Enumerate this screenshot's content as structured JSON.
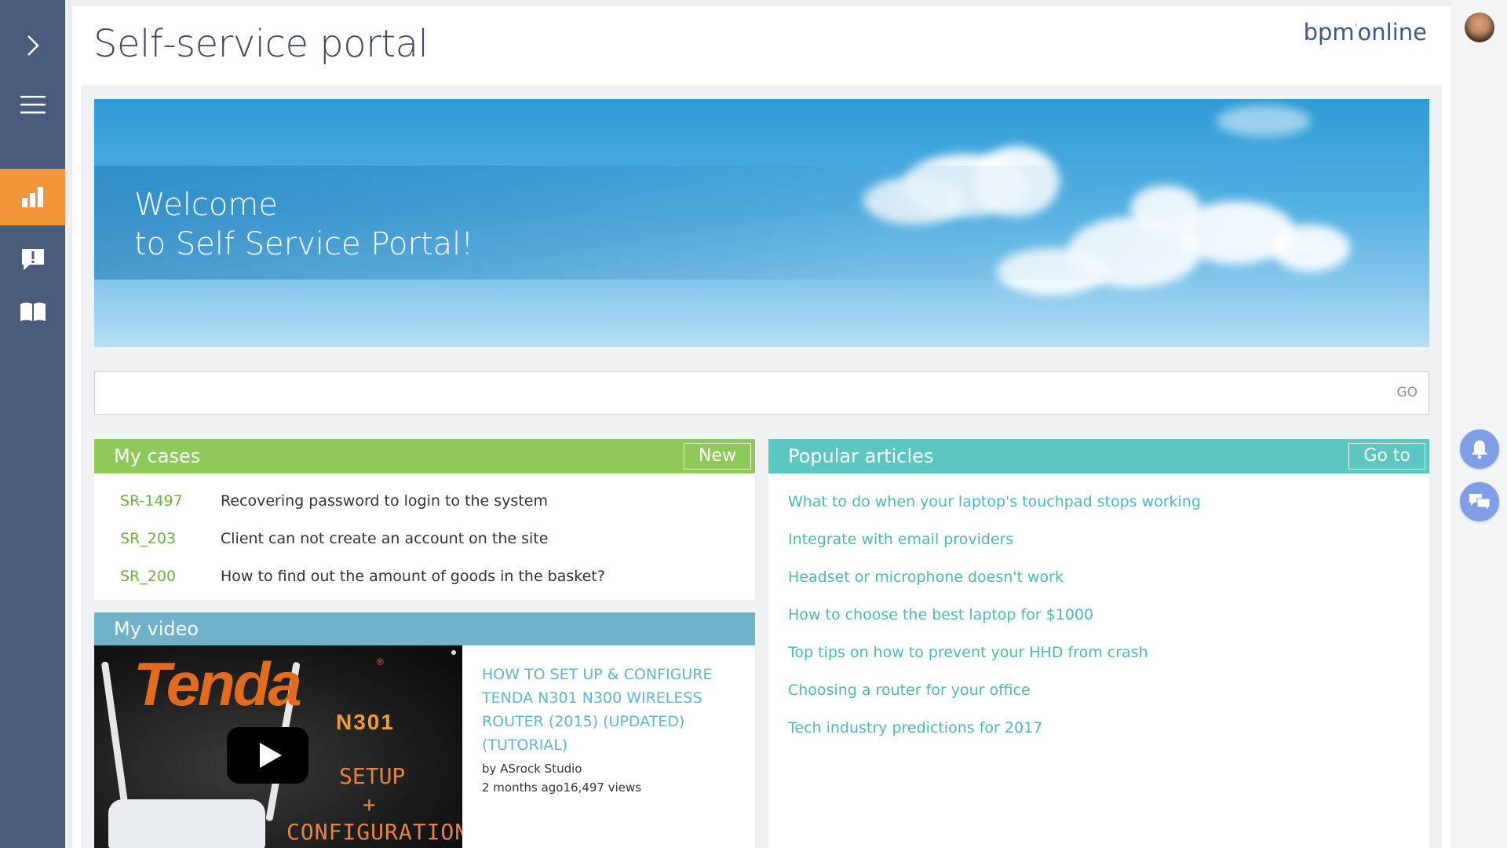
{
  "app": {
    "title": "Self-service portal",
    "brand": "bpm'online"
  },
  "nav": {
    "items": [
      {
        "icon": "chevron-right-icon"
      },
      {
        "icon": "hamburger-menu-icon"
      },
      {
        "icon": "dashboard-chart-icon",
        "active": true
      },
      {
        "icon": "cases-alert-icon"
      },
      {
        "icon": "knowledge-base-book-icon"
      }
    ]
  },
  "banner": {
    "line1": "Welcome",
    "line2": "to Self Service Portal!"
  },
  "search": {
    "value": "",
    "placeholder": "",
    "go_label": "GO"
  },
  "cases": {
    "title": "My cases",
    "new_label": "New",
    "items": [
      {
        "id": "SR-1497",
        "subject": "Recovering password to login to the system"
      },
      {
        "id": "SR_203",
        "subject": "Client can not create an account on the site"
      },
      {
        "id": "SR_200",
        "subject": "How to find out the amount of goods in the basket?"
      }
    ]
  },
  "video": {
    "title": "My video",
    "thumb_brand": "Tenda",
    "thumb_reg": "®",
    "thumb_model": "N301",
    "thumb_setup": "SETUP",
    "thumb_plus": "+",
    "thumb_config": "CONFIGURATION",
    "video_title": "HOW TO SET UP & CONFIGURE TENDA N301 N300 WIRELESS ROUTER (2015) (UPDATED) (TUTORIAL)",
    "author": "by ASrock Studio",
    "meta": "2 months ago16,497 views"
  },
  "articles": {
    "title": "Popular articles",
    "goto_label": "Go to",
    "items": [
      "What to do when your laptop's touchpad stops working",
      "Integrate with email providers",
      "Headset or microphone doesn't work",
      "How to choose the best laptop for $1000",
      "Top tips on how to prevent your HHD from crash",
      "Choosing a router for your office",
      "Tech industry predictions for 2017"
    ]
  },
  "colors": {
    "nav_bg": "#4b5b7b",
    "nav_active": "#f3963b",
    "cases_header": "#8ec95a",
    "video_header": "#6fb2c9",
    "articles_header": "#5cc7c0",
    "link_teal": "#4bb8b8",
    "fab_blue": "#7f9ee6"
  },
  "right_rail": {
    "notifications_icon": "bell-icon",
    "chat_icon": "chat-bubbles-icon"
  }
}
